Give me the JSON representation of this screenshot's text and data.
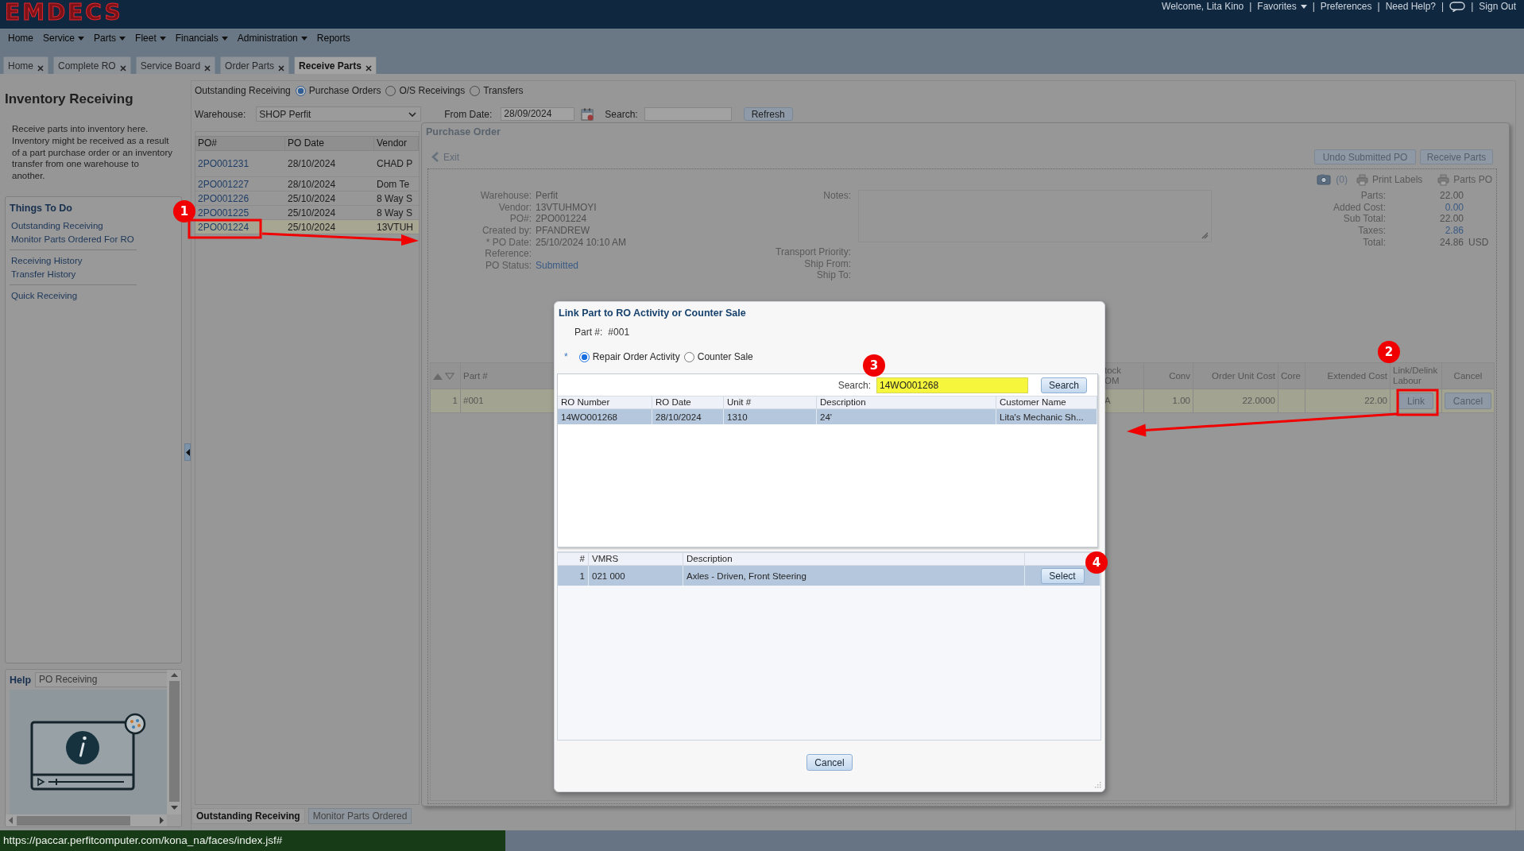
{
  "header": {
    "logo": "EMDECS",
    "user_bar": [
      {
        "kind": "text",
        "label": "Welcome, Lita Kino"
      },
      {
        "kind": "separator",
        "label": "|"
      },
      {
        "kind": "menu",
        "label": "Favorites"
      },
      {
        "kind": "separator",
        "label": "|"
      },
      {
        "kind": "link",
        "label": "Preferences"
      },
      {
        "kind": "separator",
        "label": "|"
      },
      {
        "kind": "link",
        "label": "Need Help?"
      },
      {
        "kind": "separator",
        "label": "|"
      },
      {
        "kind": "icon"
      },
      {
        "kind": "separator",
        "label": "|"
      },
      {
        "kind": "link",
        "label": "Sign Out"
      }
    ]
  },
  "menu": [
    {
      "label": "Home",
      "has_menu": false
    },
    {
      "label": "Service",
      "has_menu": true
    },
    {
      "label": "Parts",
      "has_menu": true
    },
    {
      "label": "Fleet",
      "has_menu": true
    },
    {
      "label": "Financials",
      "has_menu": true
    },
    {
      "label": "Administration",
      "has_menu": true
    },
    {
      "label": "Reports",
      "has_menu": false
    }
  ],
  "tabs": [
    {
      "label": "Home",
      "selected": false
    },
    {
      "label": "Complete RO",
      "selected": false
    },
    {
      "label": "Service Board",
      "selected": false
    },
    {
      "label": "Order Parts",
      "selected": false
    },
    {
      "label": "Receive Parts",
      "selected": true
    }
  ],
  "sidebar": {
    "title": "Inventory Receiving",
    "description": "Receive parts into inventory here. Inventory might be received as a result of a part purchase order or an inventory transfer from one warehouse to another.",
    "things_to_do": {
      "title": "Things To Do",
      "groups": [
        {
          "links": [
            "Outstanding Receiving",
            "Monitor Parts Ordered For RO"
          ]
        },
        {
          "links": [
            "Receiving History",
            "Transfer History"
          ]
        },
        {
          "links": [
            "Quick Receiving"
          ]
        }
      ]
    },
    "help": {
      "title": "Help",
      "topic": "PO Receiving"
    }
  },
  "receiving": {
    "filter_label": "Outstanding Receiving",
    "filter_options": [
      {
        "label": "Purchase Orders",
        "selected": true
      },
      {
        "label": "O/S Receivings",
        "selected": false
      },
      {
        "label": "Transfers",
        "selected": false
      }
    ],
    "warehouse": {
      "label": "Warehouse:",
      "value": "SHOP Perfit"
    },
    "from_date": {
      "label": "From Date:",
      "value": "28/09/2024"
    },
    "search": {
      "label": "Search:"
    },
    "refresh_button": "Refresh",
    "po_table": {
      "columns": [
        "PO#",
        "PO Date",
        "Vendor"
      ],
      "rows": [
        {
          "cells": [
            "2PO001231",
            "28/10/2024",
            "CHAD P"
          ],
          "selected": false
        },
        {
          "cells": [
            "2PO001227",
            "28/10/2024",
            "Dom Te"
          ],
          "selected": false
        },
        {
          "cells": [
            "2PO001226",
            "25/10/2024",
            "8 Way S"
          ],
          "selected": false
        },
        {
          "cells": [
            "2PO001225",
            "25/10/2024",
            "8 Way S"
          ],
          "selected": false
        },
        {
          "cells": [
            "2PO001224",
            "25/10/2024",
            "13VTUH"
          ],
          "selected": true
        }
      ]
    },
    "bottom_tabs": [
      {
        "label": "Outstanding Receiving",
        "selected": true
      },
      {
        "label": "Monitor Parts Ordered",
        "selected": false
      }
    ]
  },
  "purchase_order": {
    "title": "Purchase Order",
    "exit_link": "Exit",
    "buttons": [
      "Undo Submitted PO",
      "Receive Parts"
    ],
    "attachments": "(0)",
    "print_links": [
      "Print Labels",
      "Parts PO"
    ],
    "fields": [
      {
        "label": "Warehouse:",
        "value": "Perfit",
        "kind": "text"
      },
      {
        "label": "Vendor:",
        "value": "13VTUHMOYI",
        "kind": "text"
      },
      {
        "label": "PO#:",
        "value": "2PO001224",
        "kind": "text"
      },
      {
        "label": "Created by:",
        "value": "PFANDREW",
        "kind": "text"
      },
      {
        "label": "* PO Date:",
        "value": "25/10/2024 10:10 AM",
        "kind": "text"
      },
      {
        "label": "Reference:"
      },
      {
        "label": "PO Status:",
        "value": "Submitted",
        "kind": "link"
      }
    ],
    "notes": {
      "label": "Notes:"
    },
    "shipping": [
      {
        "label": "Transport Priority:"
      },
      {
        "label": "Ship From:"
      },
      {
        "label": "Ship To:"
      }
    ],
    "totals": [
      {
        "label": "Parts:",
        "value": "22.00",
        "kind": "text"
      },
      {
        "label": "Added Cost:",
        "value": "0.00",
        "kind": "link"
      },
      {
        "label": "Sub Total:",
        "value": "22.00",
        "kind": "text"
      },
      {
        "label": "Taxes:",
        "value": "2.86",
        "kind": "link"
      },
      {
        "label": "Total:",
        "value": "24.86",
        "currency": "USD",
        "kind": "text"
      }
    ],
    "grid": {
      "columns": [
        "Part #",
        "tock OM",
        "Conv",
        "Order Unit Cost",
        "Core",
        "Extended Cost",
        "Link/Delink Labour",
        "Cancel"
      ],
      "rows": [
        {
          "number": "1",
          "part": "#001",
          "uom": "A",
          "conv": "1.00",
          "unit_cost": "22.0000",
          "extended_cost": "22.00",
          "link_button": "Link",
          "cancel_button": "Cancel",
          "selected": true
        }
      ]
    }
  },
  "dialog": {
    "title": "Link Part to RO Activity or Counter Sale",
    "part_label": "Part #:",
    "part_value": "#001",
    "required_mark": "*",
    "link_types": [
      {
        "label": "Repair Order Activity",
        "selected": true
      },
      {
        "label": "Counter Sale",
        "selected": false
      }
    ],
    "search": {
      "label": "Search:",
      "value": "14WO001268",
      "highlighted": true
    },
    "search_button": "Search",
    "ro_table": {
      "columns": [
        "RO Number",
        "RO Date",
        "Unit #",
        "Description",
        "Customer Name"
      ],
      "rows": [
        {
          "cells": [
            "14WO001268",
            "28/10/2024",
            "1310",
            "24'",
            "Lita's Mechanic Sh..."
          ],
          "selected": true
        }
      ]
    },
    "activity_table": {
      "columns": [
        "#",
        "VMRS",
        "Description"
      ],
      "rows": [
        {
          "number": "1",
          "vmrs": "021 000",
          "description": "Axles - Driven, Front Steering",
          "button": "Select",
          "selected": true
        }
      ]
    },
    "cancel_button": "Cancel"
  },
  "annotations": [
    {
      "label": "1"
    },
    {
      "label": "2"
    },
    {
      "label": "3"
    },
    {
      "label": "4"
    }
  ],
  "status_bar": {
    "url": "https://paccar.perfitcomputer.com/kona_na/faces/index.jsf#"
  }
}
